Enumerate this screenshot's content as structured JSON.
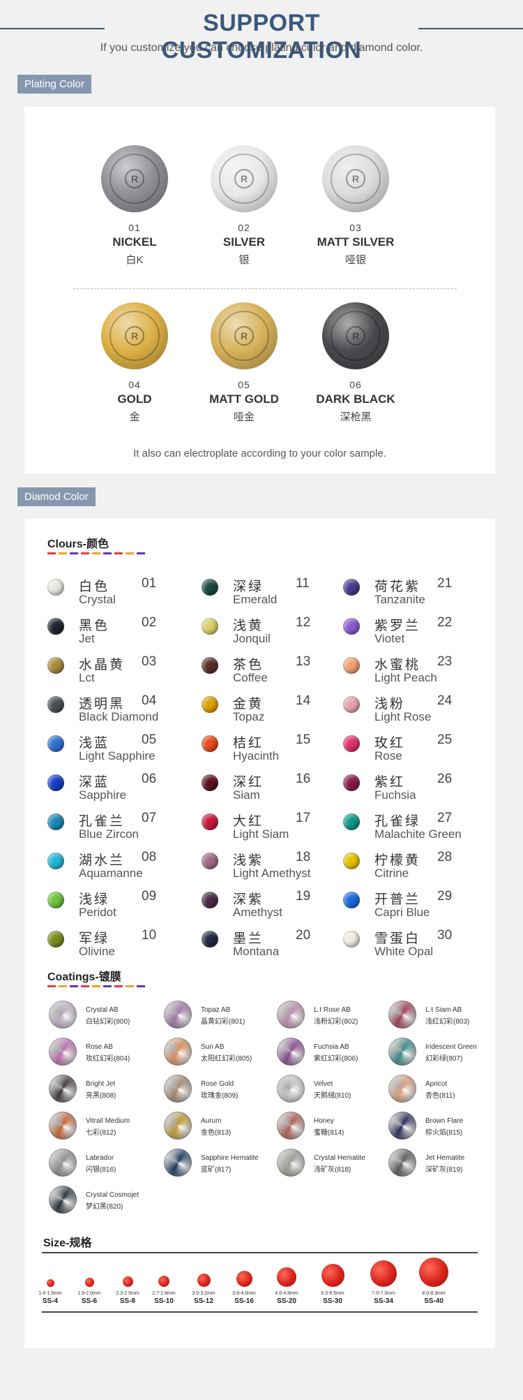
{
  "header": {
    "title": "SUPPORT CUSTOMIZATION",
    "subtitle": "If you customize,you can choose plating color and diamond color."
  },
  "plating": {
    "tag": "Plating Color",
    "logo_letter": "R",
    "items": [
      {
        "num": "01",
        "name": "NICKEL",
        "cn": "白K",
        "color": "#8e9095"
      },
      {
        "num": "02",
        "name": "SILVER",
        "cn": "银",
        "color": "#e8e8e6"
      },
      {
        "num": "03",
        "name": "MATT SILVER",
        "cn": "哑银",
        "color": "#dcdcda"
      },
      {
        "num": "04",
        "name": "GOLD",
        "cn": "金",
        "color": "#dcb046"
      },
      {
        "num": "05",
        "name": "MATT GOLD",
        "cn": "哑金",
        "color": "#d7b25a"
      },
      {
        "num": "06",
        "name": "DARK BLACK",
        "cn": "深枪黑",
        "color": "#4a4a4e"
      }
    ],
    "note": "It also can electroplate according to your color sample."
  },
  "diamond": {
    "tag": "Diamod Color",
    "colours_title": "Clours-颜色",
    "colours": [
      {
        "cn": "白色",
        "num": "01",
        "en": "Crystal",
        "color": "#e8e8e0"
      },
      {
        "cn": "黑色",
        "num": "02",
        "en": "Jet",
        "color": "#1f2330"
      },
      {
        "cn": "水晶黄",
        "num": "03",
        "en": "Lct",
        "color": "#a88a3a"
      },
      {
        "cn": "透明黑",
        "num": "04",
        "en": "Black Diamond",
        "color": "#4a4e52"
      },
      {
        "cn": "浅蓝",
        "num": "05",
        "en": "Light Sapphire",
        "color": "#2f6fd0"
      },
      {
        "cn": "深蓝",
        "num": "06",
        "en": "Sapphire",
        "color": "#1a3cc8"
      },
      {
        "cn": "孔雀兰",
        "num": "07",
        "en": "Blue Zircon",
        "color": "#1a86b8"
      },
      {
        "cn": "湖水兰",
        "num": "08",
        "en": "Aquamanne",
        "color": "#22b6d6"
      },
      {
        "cn": "浅绿",
        "num": "09",
        "en": "Peridot",
        "color": "#6fc23a"
      },
      {
        "cn": "军绿",
        "num": "10",
        "en": "Olivine",
        "color": "#7a8a1a"
      },
      {
        "cn": "深绿",
        "num": "11",
        "en": "Emerald",
        "color": "#1c4a40"
      },
      {
        "cn": "浅黄",
        "num": "12",
        "en": "Jonquil",
        "color": "#d8d06a"
      },
      {
        "cn": "茶色",
        "num": "13",
        "en": "Coffee",
        "color": "#5a3028"
      },
      {
        "cn": "金黄",
        "num": "14",
        "en": "Topaz",
        "color": "#e0a000"
      },
      {
        "cn": "桔红",
        "num": "15",
        "en": "Hyacinth",
        "color": "#e84a1a"
      },
      {
        "cn": "深红",
        "num": "16",
        "en": "Siam",
        "color": "#5a1020"
      },
      {
        "cn": "大红",
        "num": "17",
        "en": "Light Siam",
        "color": "#c8183a"
      },
      {
        "cn": "浅紫",
        "num": "18",
        "en": "Light Amethyst",
        "color": "#a06888"
      },
      {
        "cn": "深紫",
        "num": "19",
        "en": "Amethyst",
        "color": "#4a2a4a"
      },
      {
        "cn": "墨兰",
        "num": "20",
        "en": "Montana",
        "color": "#222a44"
      },
      {
        "cn": "荷花紫",
        "num": "21",
        "en": "Tanzanite",
        "color": "#4a3a90"
      },
      {
        "cn": "紫罗兰",
        "num": "22",
        "en": "Viotet",
        "color": "#8a5ad0"
      },
      {
        "cn": "水蜜桃",
        "num": "23",
        "en": "Light Peach",
        "color": "#f0a070"
      },
      {
        "cn": "浅粉",
        "num": "24",
        "en": "Light Rose",
        "color": "#e8a0b0"
      },
      {
        "cn": "玫红",
        "num": "25",
        "en": "Rose",
        "color": "#e0306a"
      },
      {
        "cn": "紫红",
        "num": "26",
        "en": "Fuchsia",
        "color": "#8a1a4a"
      },
      {
        "cn": "孔雀绿",
        "num": "27",
        "en": "Malachite Green",
        "color": "#0a9a8a"
      },
      {
        "cn": "柠檬黄",
        "num": "28",
        "en": "Citrine",
        "color": "#e8c000"
      },
      {
        "cn": "开普兰",
        "num": "29",
        "en": "Capri Blue",
        "color": "#1a6ae0"
      },
      {
        "cn": "雪蛋白",
        "num": "30",
        "en": "White Opal",
        "color": "#f0ece0"
      }
    ],
    "coatings_title": "Coatings-镀膜",
    "coatings": [
      {
        "en": "Crystal AB",
        "cn": "白钻幻彩(800)",
        "color": "#c0b4c8"
      },
      {
        "en": "Topaz AB",
        "cn": "晶黄幻彩(801)",
        "color": "#a078a8"
      },
      {
        "en": "L.t Rose AB",
        "cn": "浅粉幻彩(802)",
        "color": "#c090b0"
      },
      {
        "en": "L.t Siam AB",
        "cn": "浅红幻彩(803)",
        "color": "#a04058"
      },
      {
        "en": "Rose AB",
        "cn": "玫红幻彩(804)",
        "color": "#c070b0"
      },
      {
        "en": "Sun AB",
        "cn": "太阳红幻彩(805)",
        "color": "#e09060"
      },
      {
        "en": "Fuchsia AB",
        "cn": "紫红幻彩(806)",
        "color": "#8a4a90"
      },
      {
        "en": "Iridescent Green",
        "cn": "幻彩绿(807)",
        "color": "#3a8a88"
      },
      {
        "en": "Bright Jet",
        "cn": "亮黑(808)",
        "color": "#403838"
      },
      {
        "en": "Rose Gold",
        "cn": "玫瑰金(809)",
        "color": "#a88870"
      },
      {
        "en": "Velvet",
        "cn": "天鹅绒(810)",
        "color": "#c8c8c8"
      },
      {
        "en": "Apricot",
        "cn": "杏色(811)",
        "color": "#e0a080"
      },
      {
        "en": "Vitrail Medium",
        "cn": "七彩(812)",
        "color": "#c86838"
      },
      {
        "en": "Aurum",
        "cn": "金色(813)",
        "color": "#c09a30"
      },
      {
        "en": "Honey",
        "cn": "蜜糖(814)",
        "color": "#b06058"
      },
      {
        "en": "Brown Flare",
        "cn": "棕火焰(815)",
        "color": "#2a2a60"
      },
      {
        "en": "Labrador",
        "cn": "闪银(816)",
        "color": "#909090"
      },
      {
        "en": "Sapphire Hematite",
        "cn": "蓝矿(817)",
        "color": "#1a3a60"
      },
      {
        "en": "Crystal Hematite",
        "cn": "浅矿灰(818)",
        "color": "#a0a098"
      },
      {
        "en": "Jet Hematite",
        "cn": "深矿灰(819)",
        "color": "#5a5a58"
      },
      {
        "en": "Crystal Cosmojet",
        "cn": "梦幻黑(820)",
        "color": "#283038"
      }
    ],
    "size_title": "Size-规格",
    "sizes": [
      {
        "mm": "1.4-1.5mm",
        "ss": "SS-4",
        "rel": 0.14
      },
      {
        "mm": "1.9-2.0mm",
        "ss": "SS-6",
        "rel": 0.19
      },
      {
        "mm": "2.3-2.5mm",
        "ss": "SS-8",
        "rel": 0.24
      },
      {
        "mm": "2.7-2.8mm",
        "ss": "SS-10",
        "rel": 0.28
      },
      {
        "mm": "3.0-3.2mm",
        "ss": "SS-12",
        "rel": 0.37
      },
      {
        "mm": "3.8-4.0mm",
        "ss": "SS-16",
        "rel": 0.47
      },
      {
        "mm": "4.6-4.8mm",
        "ss": "SS-20",
        "rel": 0.6
      },
      {
        "mm": "6.3-6.5mm",
        "ss": "SS-30",
        "rel": 0.75
      },
      {
        "mm": "7.0-7.3mm",
        "ss": "SS-34",
        "rel": 0.9
      },
      {
        "mm": "8.0-8.3mm",
        "ss": "SS-40",
        "rel": 1.0
      }
    ]
  }
}
